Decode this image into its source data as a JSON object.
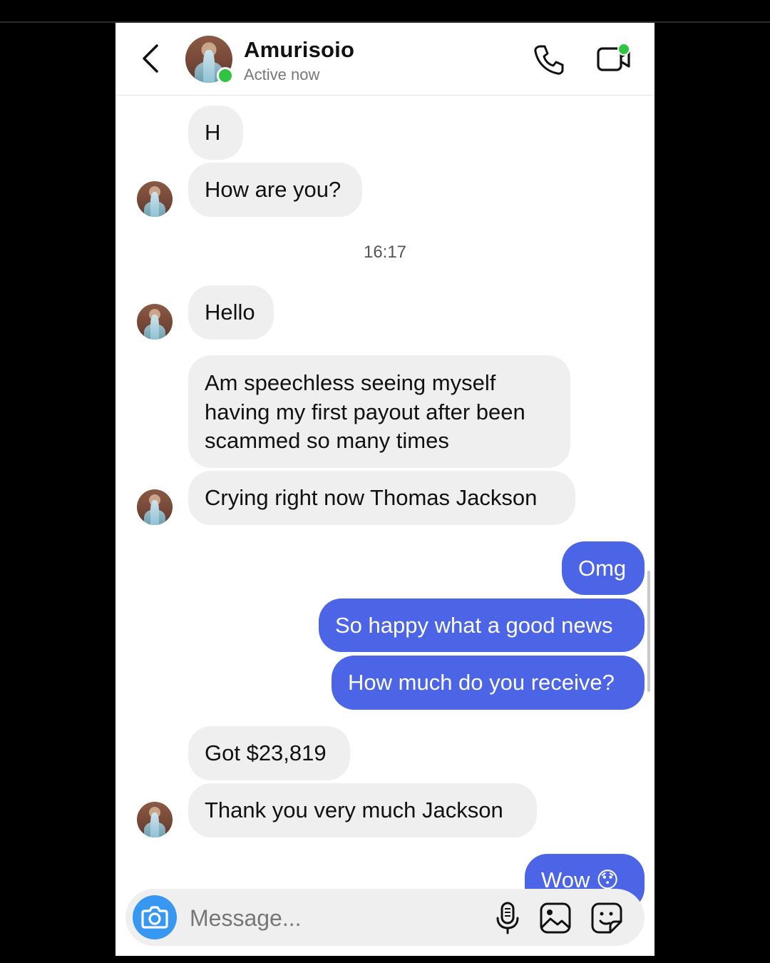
{
  "header": {
    "contact_name": "Amurisoio",
    "status": "Active now"
  },
  "messages": [
    {
      "side": "in",
      "text": "H"
    },
    {
      "side": "in",
      "text": "How are you?"
    },
    {
      "side": "in",
      "text": "Hello"
    },
    {
      "side": "in",
      "text": "Am speechless seeing myself having my first payout after been scammed so many times"
    },
    {
      "side": "in",
      "text": "Crying right now Thomas Jackson"
    },
    {
      "side": "out",
      "text": "Omg"
    },
    {
      "side": "out",
      "text": "So happy what a good news"
    },
    {
      "side": "out",
      "text": "How much do you receive?"
    },
    {
      "side": "in",
      "text": "Got $23,819"
    },
    {
      "side": "in",
      "text": "Thank you very much Jackson"
    },
    {
      "side": "out",
      "text": "Wow",
      "emoji": "😯"
    }
  ],
  "timestamp": "16:17",
  "composer": {
    "placeholder": "Message..."
  },
  "colors": {
    "outgoing_bubble": "#4c64e6",
    "incoming_bubble": "#efefef",
    "online": "#31c441",
    "camera_button": "#3897f0"
  },
  "icons": [
    "back-arrow-icon",
    "phone-icon",
    "video-camera-icon",
    "camera-icon",
    "microphone-icon",
    "gallery-icon",
    "sticker-icon"
  ]
}
